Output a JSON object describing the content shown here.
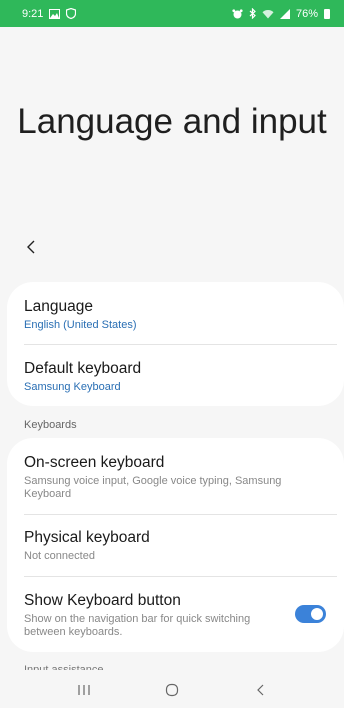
{
  "status_bar": {
    "time": "9:21",
    "battery": "76%"
  },
  "page": {
    "title": "Language and input"
  },
  "card1": {
    "language": {
      "title": "Language",
      "value": "English (United States)"
    },
    "default_keyboard": {
      "title": "Default keyboard",
      "value": "Samsung Keyboard"
    }
  },
  "keyboards_header": "Keyboards",
  "card2": {
    "onscreen": {
      "title": "On-screen keyboard",
      "sub": "Samsung voice input, Google voice typing, Samsung Keyboard"
    },
    "physical": {
      "title": "Physical keyboard",
      "sub": "Not connected"
    },
    "show_button": {
      "title": "Show Keyboard button",
      "sub": "Show on the navigation bar for quick switching between keyboards.",
      "enabled": true
    }
  },
  "next_header": "Input assistance",
  "colors": {
    "status_bar": "#2fb85a",
    "accent": "#3b82d9",
    "link": "#2a6fb4"
  }
}
